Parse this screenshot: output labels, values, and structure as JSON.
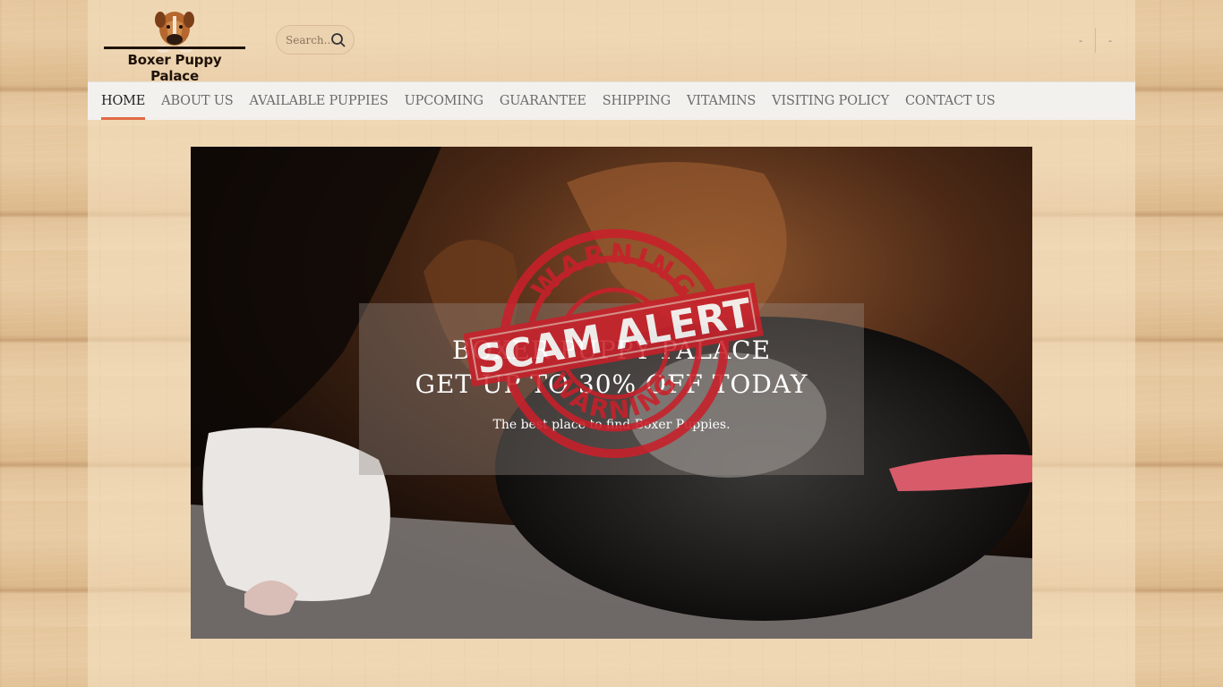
{
  "site": {
    "logo_text": "Boxer Puppy Palace"
  },
  "search": {
    "placeholder": "Search..."
  },
  "header_right": {
    "item1": "-",
    "item2": "-"
  },
  "nav": {
    "items": [
      {
        "label": "HOME",
        "active": true
      },
      {
        "label": "ABOUT US"
      },
      {
        "label": "AVAILABLE PUPPIES"
      },
      {
        "label": "UPCOMING"
      },
      {
        "label": "GUARANTEE"
      },
      {
        "label": "SHIPPING"
      },
      {
        "label": "VITAMINS"
      },
      {
        "label": "VISITING POLICY"
      },
      {
        "label": "CONTACT US"
      }
    ]
  },
  "hero": {
    "line1": "BOXER PUPPY PALACE",
    "line2": "GET UP TO 30% OFF TODAY",
    "subtitle": "The best place to find Boxer Puppies."
  },
  "stamp": {
    "top_text": "WARNING",
    "center_text": "SCAM ALERT",
    "bottom_text": "WARNING",
    "color": "#c9202a"
  },
  "colors": {
    "nav_active_underline": "#e06a45",
    "nav_bg": "#f3f1ee"
  }
}
